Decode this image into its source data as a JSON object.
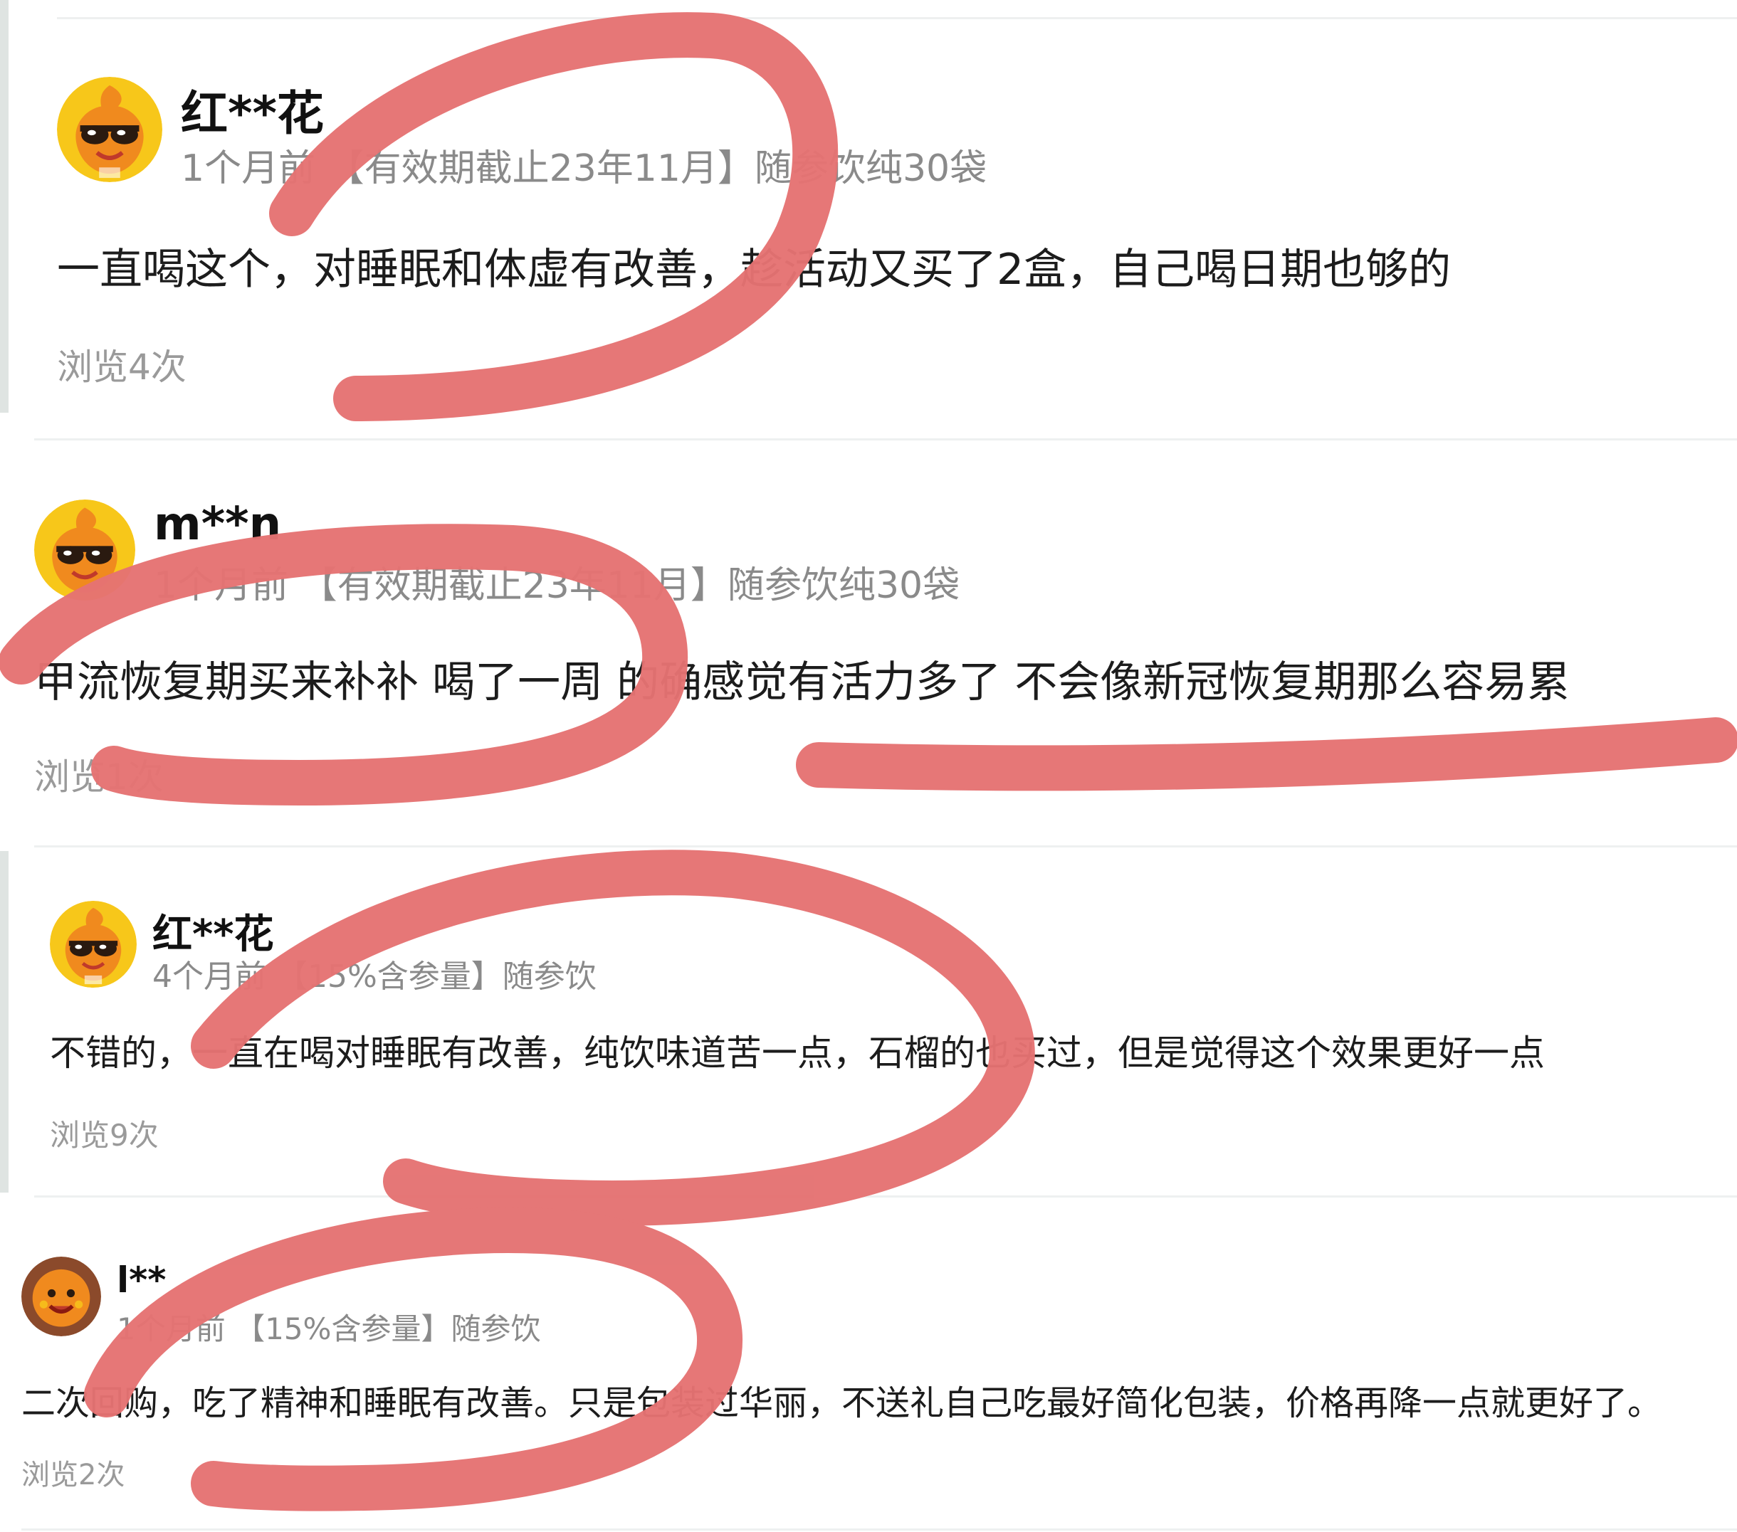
{
  "reviews": [
    {
      "username": "红**花",
      "time": "1个月前",
      "product": "【有效期截止23年11月】随参饮纯30袋",
      "text": "一直喝这个，对睡眠和体虚有改善，趁活动又买了2盒，自己喝日期也够的",
      "views": "浏览4次",
      "avatar_icon": "cartoon-sunglasses-mascot-icon"
    },
    {
      "username": "m**n",
      "time": "1个月前",
      "product": "【有效期截止23年11月】随参饮纯30袋",
      "text": "甲流恢复期买来补补 喝了一周 的确感觉有活力多了 不会像新冠恢复期那么容易累",
      "views": "浏览1次",
      "avatar_icon": "cartoon-sunglasses-mascot-icon"
    },
    {
      "username": "红**花",
      "time": "4个月前",
      "product": "【15%含参量】随参饮",
      "text": "不错的，一直在喝对睡眠有改善，纯饮味道苦一点，石榴的也买过，但是觉得这个效果更好一点",
      "views": "浏览9次",
      "avatar_icon": "cartoon-sunglasses-mascot-icon"
    },
    {
      "username": "l**",
      "time": "1个月前",
      "product": "【15%含参量】随参饮",
      "text": "二次回购，吃了精神和睡眠有改善。只是包装过华丽，不送礼自己吃最好简化包装，价格再降一点就更好了。",
      "views": "浏览2次",
      "avatar_icon": "cartoon-smiling-mascot-icon"
    }
  ],
  "colors": {
    "scribble": "#e57373",
    "meta_text": "#8a8a8a",
    "avatar_orange": "#f08a1e",
    "avatar_yellow": "#f7c71a"
  }
}
